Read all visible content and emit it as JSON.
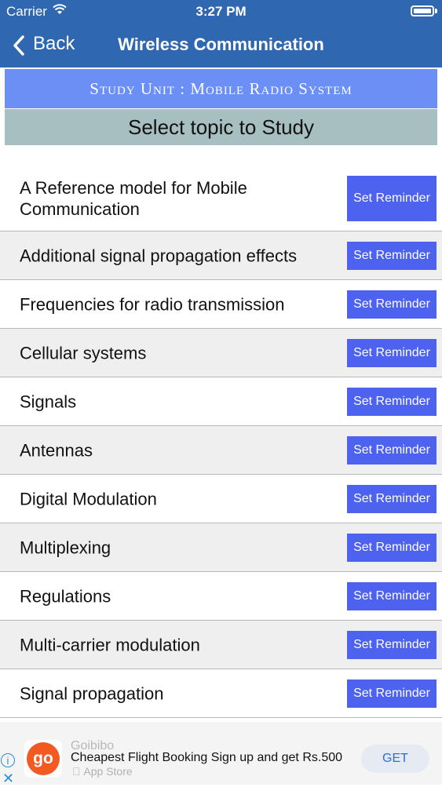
{
  "status_bar": {
    "carrier": "Carrier",
    "time": "3:27 PM",
    "icons": [
      "wifi-icon",
      "battery-icon"
    ]
  },
  "nav": {
    "back_label": "Back",
    "title": "Wireless Communication",
    "back_icon": "chevron-left-icon"
  },
  "unit_banner": "Study Unit : Mobile Radio System",
  "select_prompt": "Select topic to Study",
  "reminder_label": "Set Reminder",
  "topics": [
    "A Reference model for Mobile Communication",
    "Additional signal propagation effects",
    "Frequencies for radio transmission",
    "Cellular systems",
    "Signals",
    "Antennas",
    "Digital Modulation",
    "Multiplexing",
    "Regulations",
    "Multi-carrier modulation",
    "Signal propagation"
  ],
  "ad": {
    "brand": "Goibibo",
    "text": "Cheapest Flight Booking Sign up and get Rs.500",
    "store": "App Store",
    "logo_text": "go",
    "cta": "GET",
    "info_icon": "info-icon",
    "close_icon": "close-icon"
  },
  "colors": {
    "nav": "#2f67b1",
    "banner": "#6b8ff5",
    "select_bar": "#a7bfc0",
    "button": "#4d63f0",
    "ad_logo": "#f25a22"
  }
}
